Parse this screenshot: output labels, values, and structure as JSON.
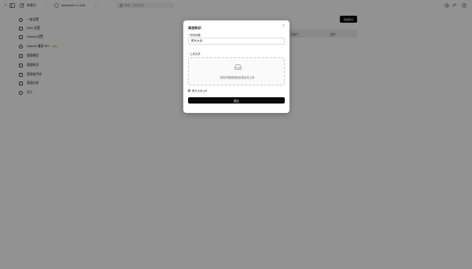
{
  "topbar": {
    "new_chat": "新聊天",
    "more": "···",
    "model": "deepseek-r1:14b",
    "search_placeholder": "搜索 · 对话历史",
    "icons": [
      "back-icon",
      "sidebar-toggle-icon",
      "new-chat-icon",
      "model-icon",
      "settings-icon",
      "share-icon",
      "profile-icon"
    ]
  },
  "sidebar": {
    "items": [
      {
        "label": "一般设置",
        "icon": "general-icon"
      },
      {
        "label": "RAG 设置",
        "icon": "rag-icon"
      },
      {
        "label": "Ollama 设置",
        "icon": "ollama-icon"
      },
      {
        "label": "OpenAI 兼容 API",
        "icon": "api-icon",
        "badge": "Beta"
      },
      {
        "label": "管理模型",
        "icon": "models-icon"
      },
      {
        "label": "管理知识",
        "icon": "knowledge-icon",
        "active": true
      },
      {
        "label": "管理助手库",
        "icon": "assistants-icon"
      },
      {
        "label": "管理共享",
        "icon": "share-icon"
      },
      {
        "label": "关于",
        "icon": "about-icon"
      }
    ]
  },
  "main": {
    "add_button": "添加知识",
    "table_headers": [
      "创建于",
      "操作"
    ]
  },
  "modal": {
    "title": "添加知识",
    "close": "×",
    "title_label": "知识标题",
    "title_value": "佩头大全",
    "upload_label": "上传文件",
    "dropzone_text": "将文件拖放到此处或点击上传",
    "file_name": "佩头大全.pdf",
    "submit": "提交"
  }
}
